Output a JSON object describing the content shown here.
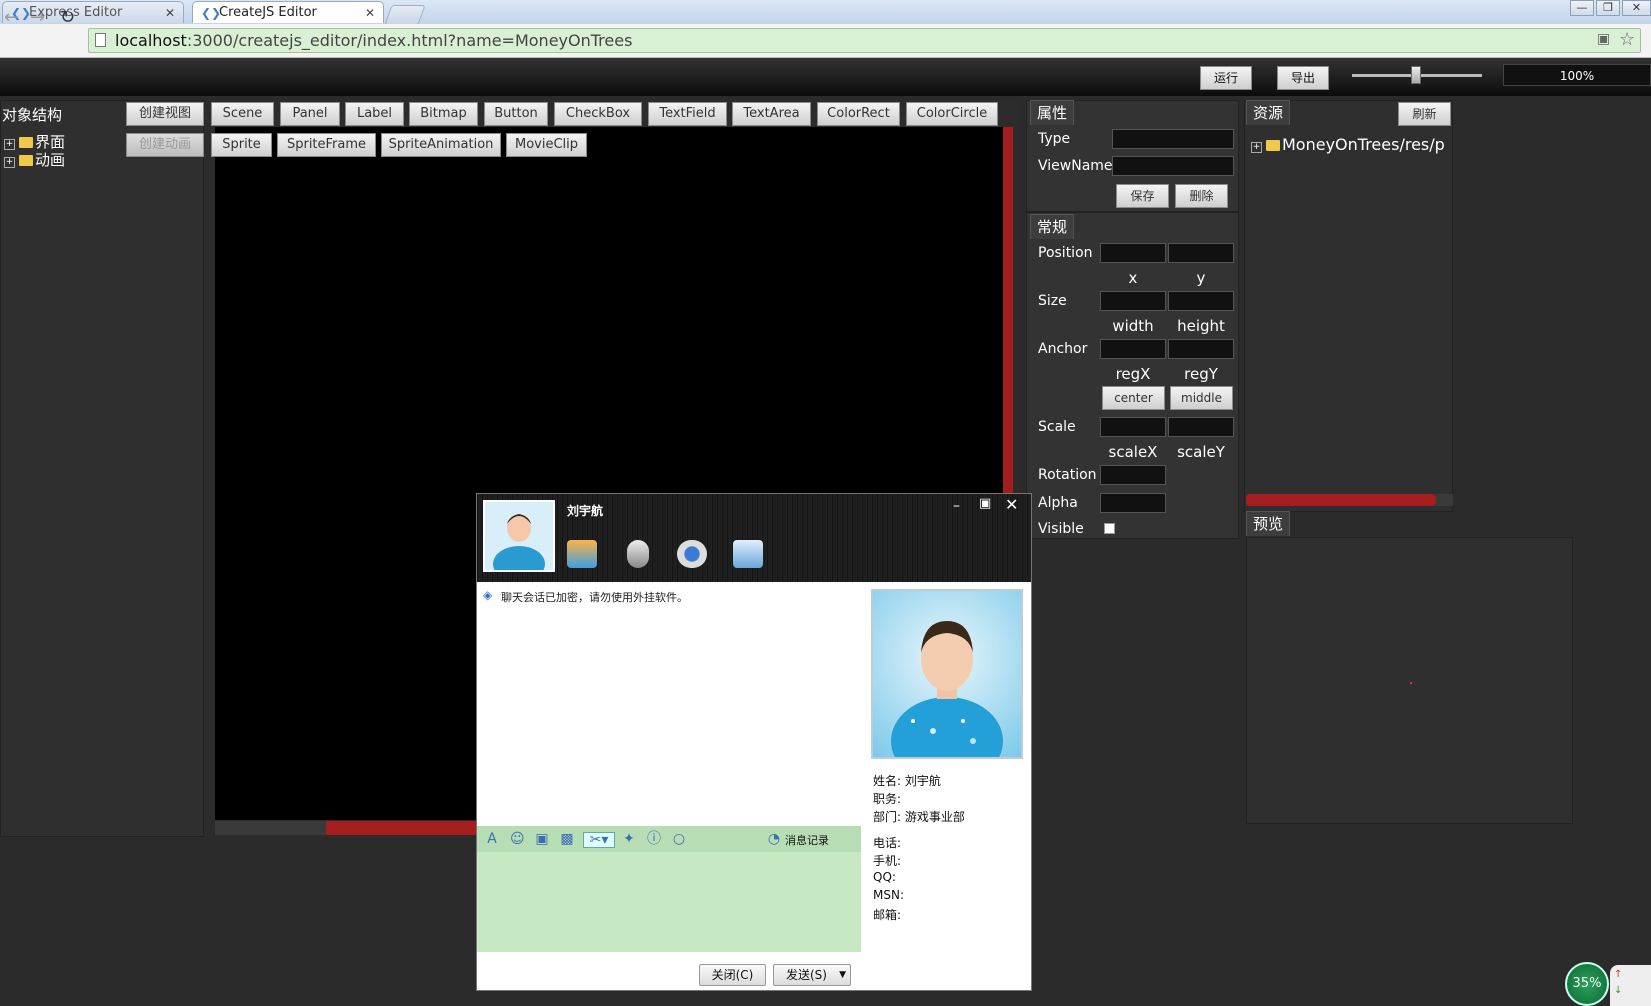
{
  "browser": {
    "tabs": [
      {
        "label": "Express Editor",
        "active": false
      },
      {
        "label": "CreateJS Editor",
        "active": true
      }
    ],
    "url_host": "localhost",
    "url_rest": ":3000/createjs_editor/index.html?name=MoneyOnTrees"
  },
  "topbar": {
    "run_label": "运行",
    "export_label": "导出",
    "zoom": "100%"
  },
  "object_panel": {
    "title": "对象结构",
    "tree": [
      "界面",
      "动画"
    ]
  },
  "toolbar_row1": {
    "create_view": "创建视图",
    "items": [
      "Scene",
      "Panel",
      "Label",
      "Bitmap",
      "Button",
      "CheckBox",
      "TextField",
      "TextArea",
      "ColorRect",
      "ColorCircle"
    ]
  },
  "toolbar_row2": {
    "create_anim": "创建动画",
    "items": [
      "Sprite",
      "SpriteFrame",
      "SpriteAnimation",
      "MovieClip"
    ]
  },
  "properties": {
    "title": "属性",
    "type_label": "Type",
    "viewname_label": "ViewName",
    "save_label": "保存",
    "delete_label": "删除"
  },
  "general": {
    "title": "常规",
    "position_label": "Position",
    "x_label": "x",
    "y_label": "y",
    "size_label": "Size",
    "width_label": "width",
    "height_label": "height",
    "anchor_label": "Anchor",
    "regx_label": "regX",
    "regy_label": "regY",
    "center_label": "center",
    "middle_label": "middle",
    "scale_label": "Scale",
    "scalex_label": "scaleX",
    "scaley_label": "scaleY",
    "rotation_label": "Rotation",
    "alpha_label": "Alpha",
    "visible_label": "Visible"
  },
  "resources": {
    "title": "资源",
    "refresh_label": "刷新",
    "tree_item": "MoneyOnTrees/res/p"
  },
  "preview": {
    "title": "预览"
  },
  "chat": {
    "contact_name": "刘宇航",
    "notice": "聊天会话已加密，请勿使用外挂软件。",
    "history_label": "消息记录",
    "close_label": "关闭(C)",
    "send_label": "发送(S)",
    "info": [
      {
        "key": "姓名:",
        "value": "刘宇航"
      },
      {
        "key": "职务:",
        "value": ""
      },
      {
        "key": "部门:",
        "value": "游戏事业部"
      },
      {
        "key": "电话:",
        "value": ""
      },
      {
        "key": "手机:",
        "value": ""
      },
      {
        "key": "QQ:",
        "value": ""
      },
      {
        "key": "MSN:",
        "value": ""
      },
      {
        "key": "邮箱:",
        "value": ""
      }
    ]
  },
  "tray": {
    "cpu": "35%"
  },
  "colors": {
    "accent_green": "#d9f0d4",
    "chat_input": "#c6e8c3",
    "scroll_red": "#a51d1d"
  }
}
